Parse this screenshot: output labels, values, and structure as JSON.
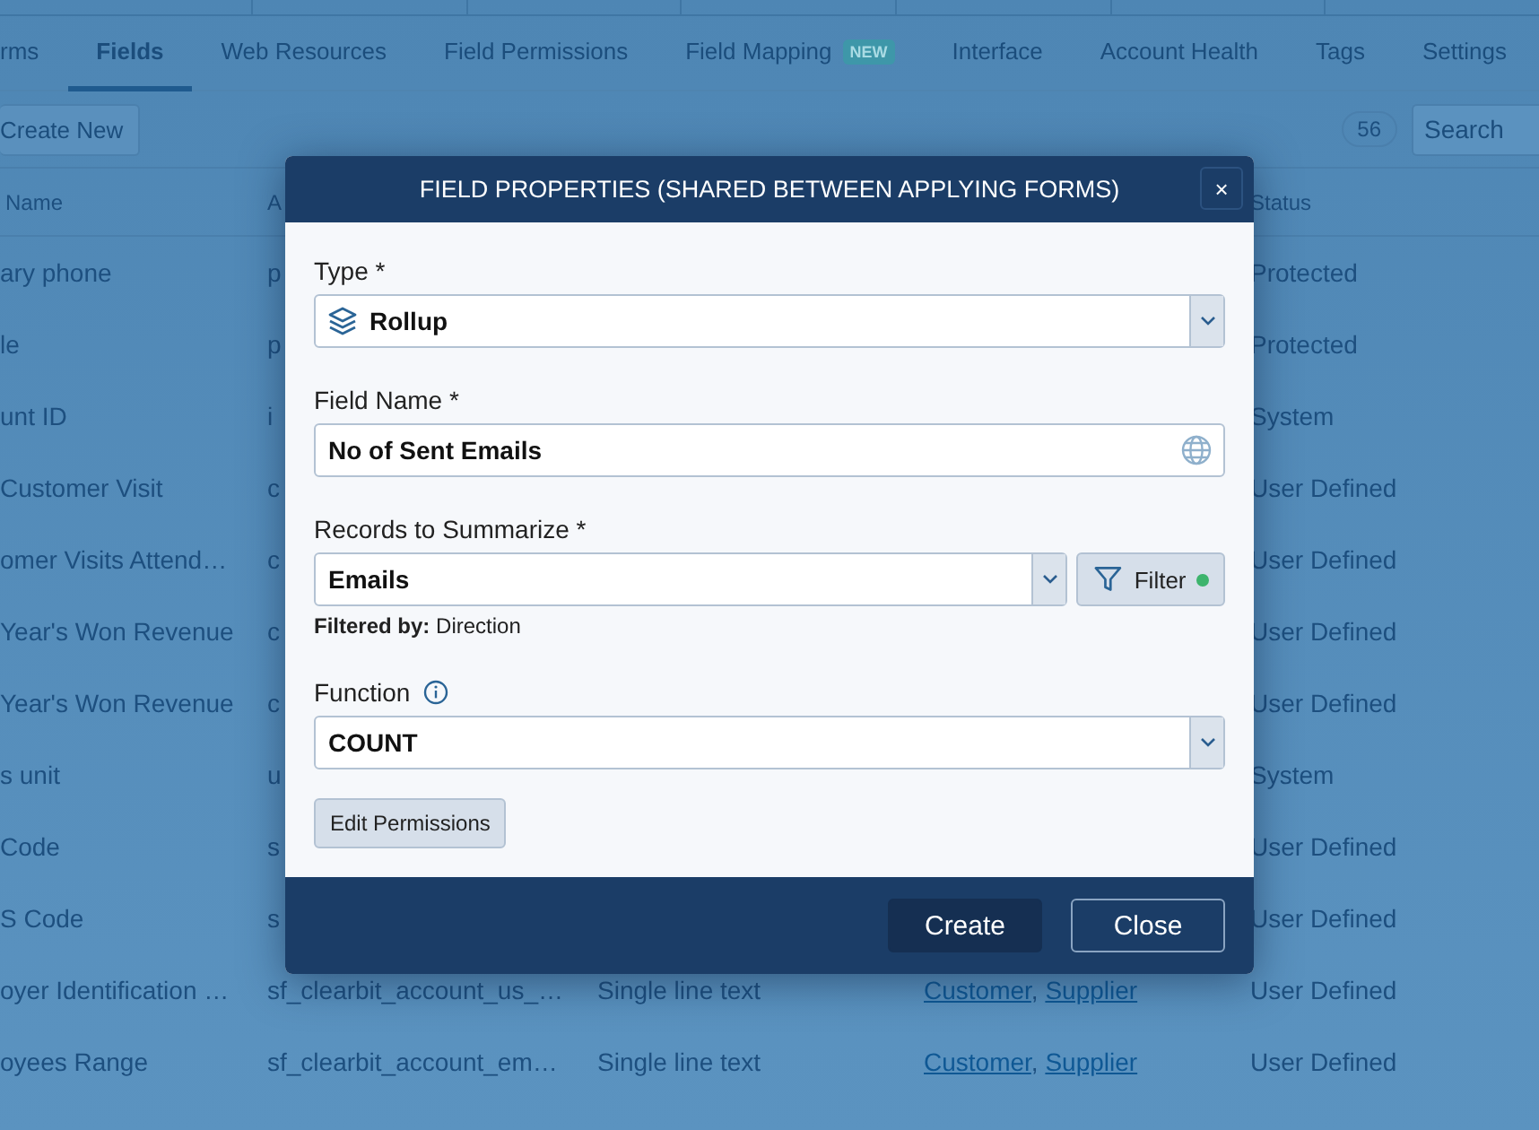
{
  "tabs": [
    {
      "label": "rms",
      "selected": false
    },
    {
      "label": "Fields",
      "selected": true
    },
    {
      "label": "Web Resources",
      "selected": false
    },
    {
      "label": "Field Permissions",
      "selected": false
    },
    {
      "label": "Field Mapping",
      "selected": false,
      "badge": "NEW"
    },
    {
      "label": "Interface",
      "selected": false
    },
    {
      "label": "Account Health",
      "selected": false
    },
    {
      "label": "Tags",
      "selected": false
    },
    {
      "label": "Settings",
      "selected": false
    }
  ],
  "toolbar": {
    "create_button": "Create New",
    "count": "56",
    "search": {
      "placeholder": "Search"
    }
  },
  "table": {
    "columns": [
      "Name",
      "A",
      "",
      "",
      "Status"
    ],
    "rows": [
      {
        "cells": [
          "ary phone",
          "p",
          "",
          "",
          "Protected"
        ]
      },
      {
        "cells": [
          "le",
          "p",
          "",
          "",
          "Protected"
        ]
      },
      {
        "cells": [
          "unt ID",
          "i",
          "",
          "",
          "System"
        ]
      },
      {
        "cells": [
          "Customer Visit",
          "c",
          "",
          "",
          "User Defined"
        ]
      },
      {
        "cells": [
          "omer Visits Attend…",
          "c",
          "",
          "",
          "User Defined"
        ]
      },
      {
        "cells": [
          "Year's Won Revenue",
          "c",
          "",
          "",
          "User Defined"
        ]
      },
      {
        "cells": [
          "Year's Won Revenue",
          "c",
          "",
          "",
          "User Defined"
        ]
      },
      {
        "cells": [
          "s unit",
          "u",
          "",
          "",
          "System"
        ]
      },
      {
        "cells": [
          "Code",
          "s",
          "",
          "",
          "User Defined"
        ]
      },
      {
        "cells": [
          "S Code",
          "s",
          "",
          "",
          "User Defined"
        ]
      },
      {
        "cells": [
          "oyer Identification …",
          "sf_clearbit_account_us_…",
          "Single line text",
          "",
          "User Defined"
        ],
        "forms": [
          "Customer",
          "Supplier"
        ],
        "separator": ","
      },
      {
        "cells": [
          "oyees Range",
          "sf_clearbit_account_em…",
          "Single line text",
          "",
          "User Defined"
        ],
        "forms": [
          "Customer",
          "Supplier"
        ],
        "separator": ","
      }
    ]
  },
  "modal": {
    "title": "FIELD PROPERTIES (SHARED BETWEEN APPLYING FORMS)",
    "close": "×",
    "type": {
      "label": "Type *",
      "value": "Rollup"
    },
    "field_name": {
      "label": "Field Name *",
      "value": "No of Sent Emails"
    },
    "records": {
      "label": "Records to Summarize *",
      "value": "Emails",
      "filter": {
        "label": "Filter",
        "active": true
      },
      "filtered_by": "**Filtered by:** Direction"
    },
    "function": {
      "label": "Function",
      "value": "COUNT"
    },
    "edit_permissions": "Edit Permissions",
    "buttons": [
      {
        "label": "Create",
        "primary": true
      },
      {
        "label": "Close",
        "primary": false
      }
    ]
  }
}
